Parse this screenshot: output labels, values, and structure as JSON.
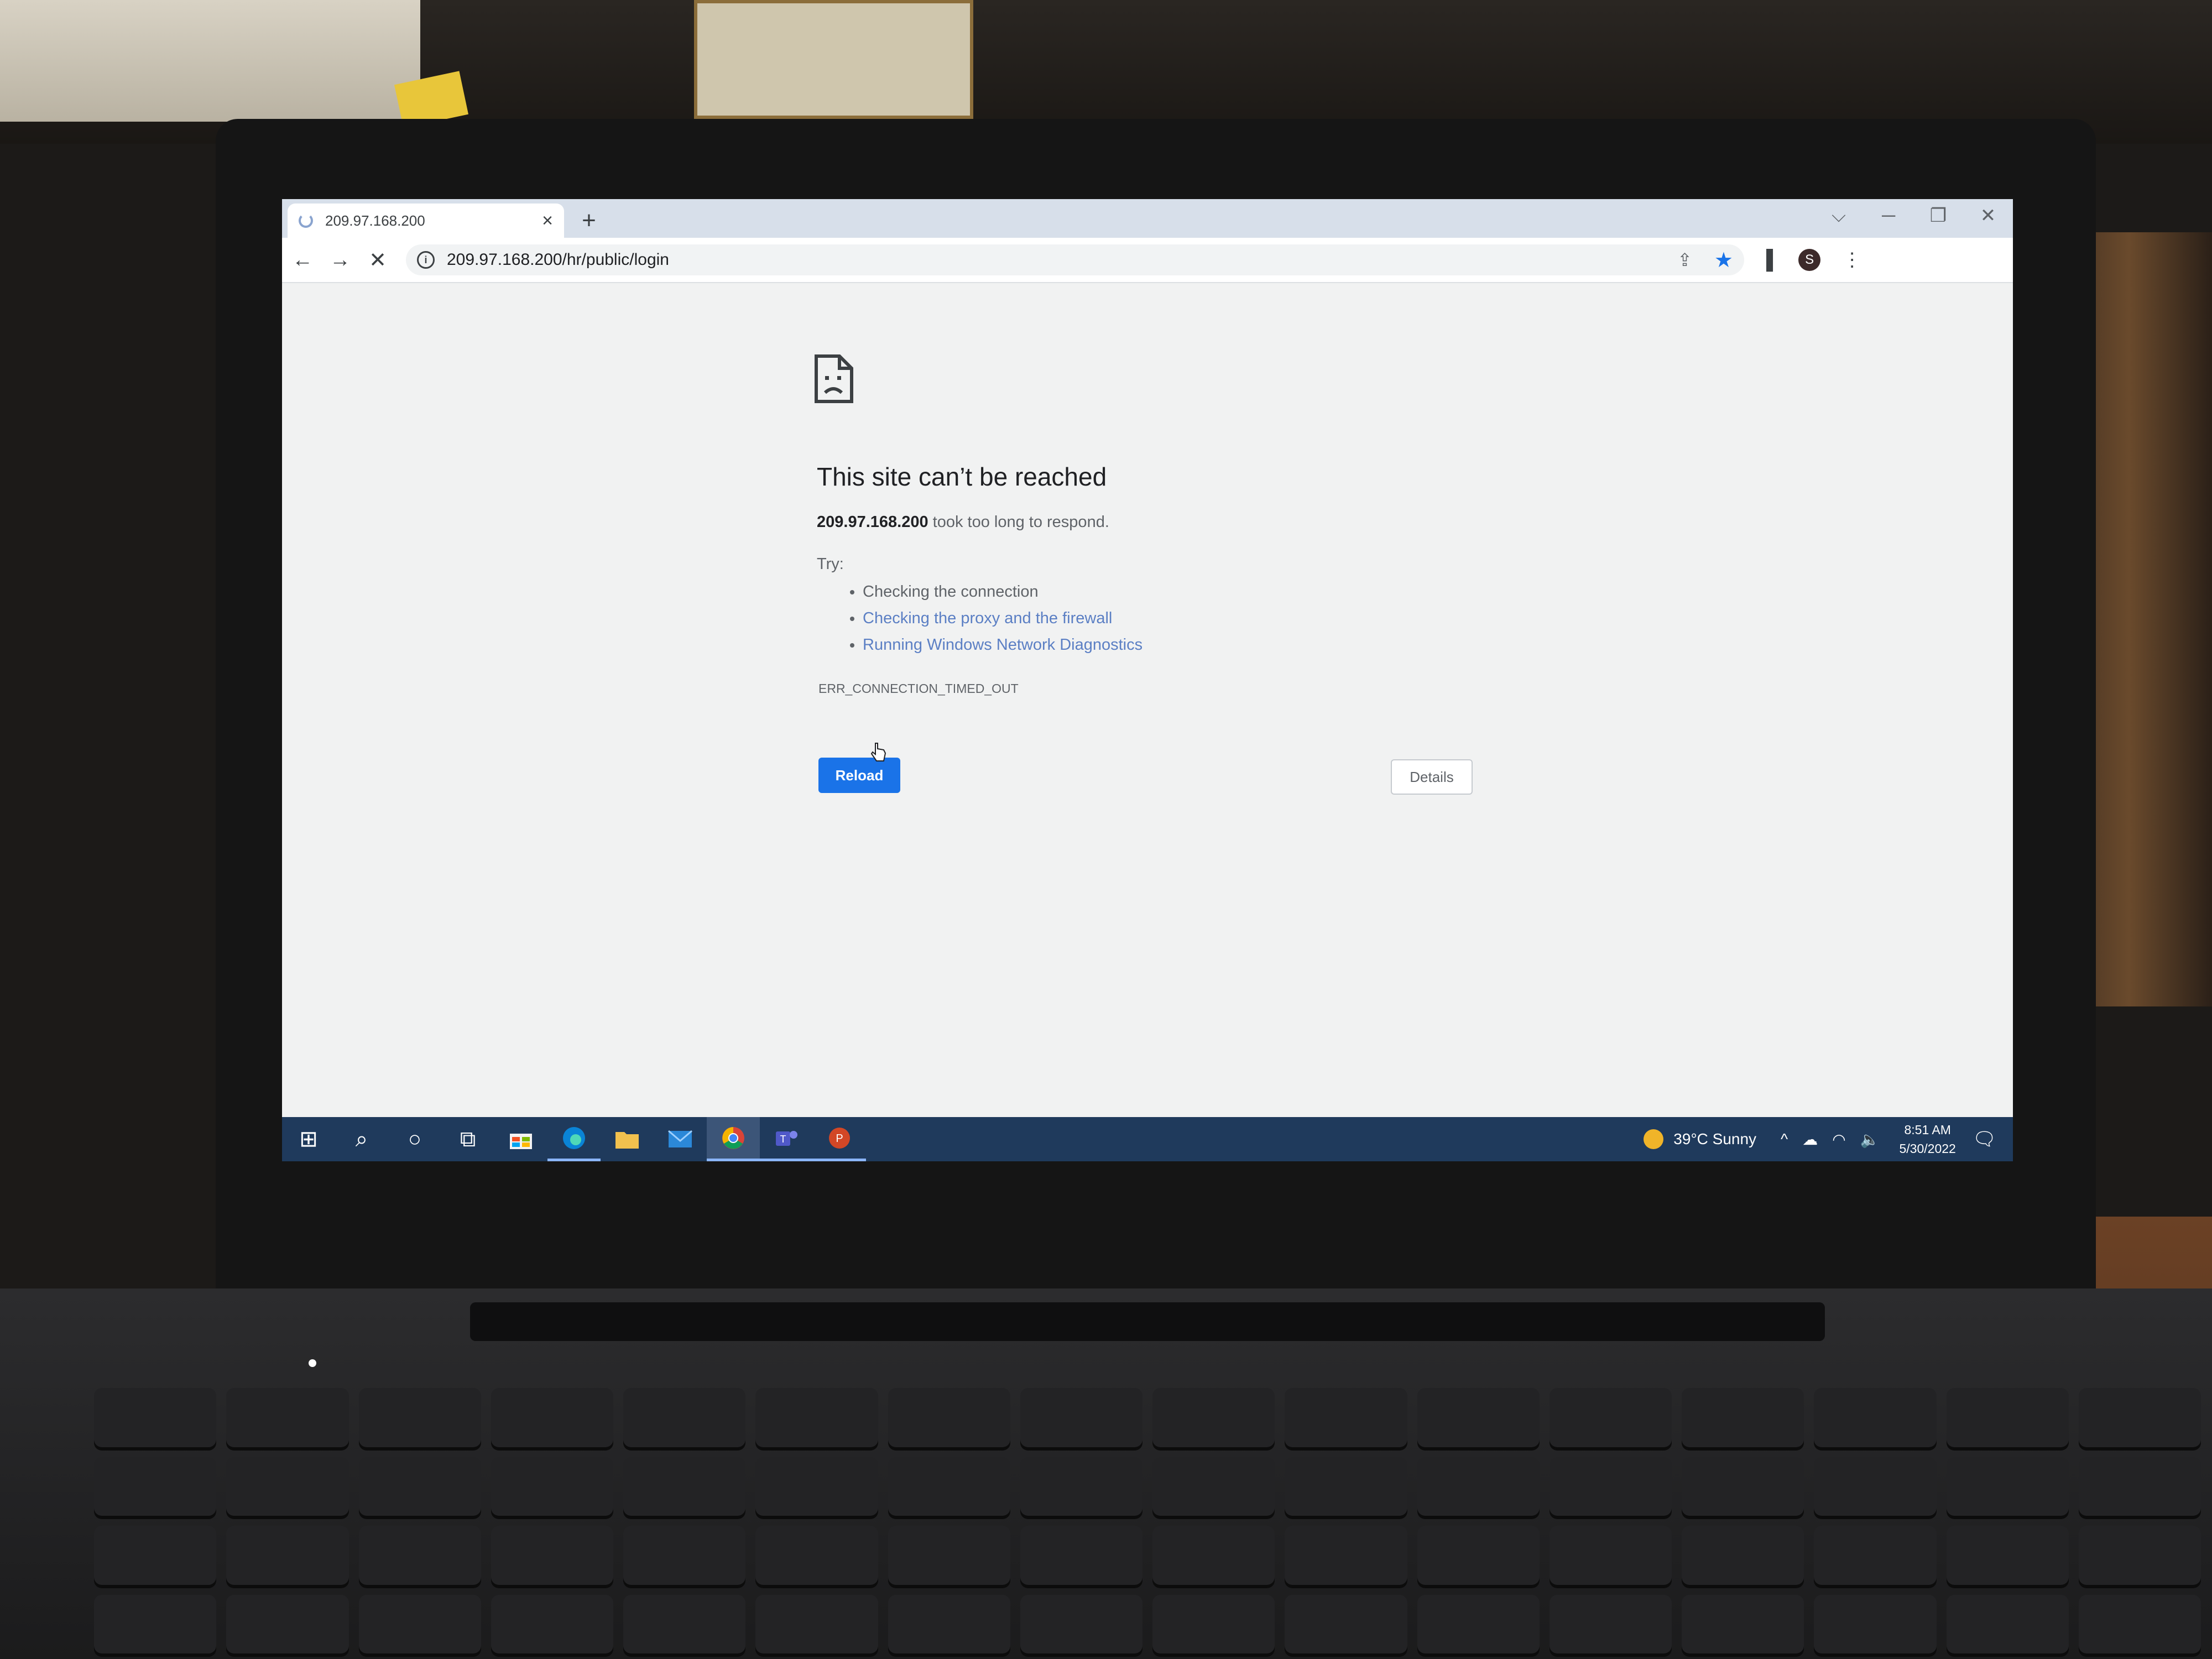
{
  "browser": {
    "tab": {
      "title": "209.97.168.200",
      "close_icon": "×"
    },
    "new_tab_icon": "+",
    "window_controls": {
      "tabsearch": "⌵",
      "minimize": "─",
      "restore": "❐",
      "close": "✕"
    },
    "toolbar": {
      "back": "←",
      "forward": "→",
      "stop": "✕",
      "url": "209.97.168.200/hr/public/login",
      "info_icon": "i",
      "share_icon": "⇪",
      "star_icon": "★",
      "sidepanel_icon": "▌",
      "avatar_letter": "S",
      "menu_icon": "⋮"
    }
  },
  "error_page": {
    "title": "This site can’t be reached",
    "host": "209.97.168.200",
    "message": " took too long to respond.",
    "try_label": "Try:",
    "suggestions": [
      "Checking the connection",
      "Checking the proxy and the firewall",
      "Running Windows Network Diagnostics"
    ],
    "error_code": "ERR_CONNECTION_TIMED_OUT",
    "reload_label": "Reload",
    "details_label": "Details"
  },
  "taskbar": {
    "start": "⊞",
    "search": "⌕",
    "cortana": "○",
    "taskview": "⧉",
    "apps": [
      "store",
      "edge",
      "file-explorer",
      "mail",
      "chrome",
      "teams",
      "powerpoint"
    ],
    "weather": {
      "temp": "39°C",
      "condition": "Sunny"
    },
    "tray_chevron": "^",
    "time": "8:51 AM",
    "date": "5/30/2022",
    "notification_icon": "🗨"
  },
  "colors": {
    "accent": "#1a73e8",
    "link": "#5b7fc4",
    "taskbar": "#1f3a5c",
    "tabstrip": "#d7dfea"
  }
}
